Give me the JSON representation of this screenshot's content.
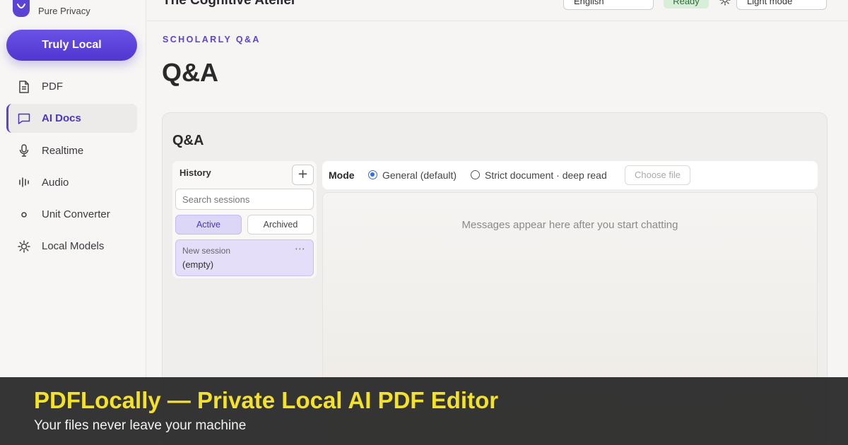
{
  "brand": {
    "subtitle": "Pure Privacy",
    "accent": "#5b43d6"
  },
  "sidebar": {
    "primary_button": "Truly Local",
    "items": [
      {
        "label": "PDF",
        "icon": "document-icon",
        "active": false
      },
      {
        "label": "AI Docs",
        "icon": "chat-bubble-icon",
        "active": true
      },
      {
        "label": "Realtime",
        "icon": "microphone-icon",
        "active": false
      },
      {
        "label": "Audio",
        "icon": "audio-waveform-icon",
        "active": false
      },
      {
        "label": "Unit Converter",
        "icon": "dot-icon",
        "active": false
      },
      {
        "label": "Local Models",
        "icon": "sun-gear-icon",
        "active": false
      }
    ]
  },
  "topbar": {
    "title": "The Cognitive Atelier",
    "language": "English",
    "status": "Ready",
    "status_color": "#d7efd9",
    "theme": "Light mode"
  },
  "page": {
    "eyebrow": "SCHOLARLY Q&A",
    "title": "Q&A"
  },
  "card": {
    "title": "Q&A",
    "history": {
      "title": "History",
      "add_label": "+",
      "search_placeholder": "Search sessions",
      "tabs": {
        "active": "Active",
        "archived": "Archived"
      },
      "sessions": [
        {
          "name": "New session",
          "preview": "(empty)",
          "more": "⋯"
        }
      ]
    },
    "mode": {
      "label": "Mode",
      "options": [
        {
          "label": "General (default)",
          "selected": true
        },
        {
          "label": "Strict document · deep read",
          "selected": false
        }
      ],
      "file_button": "Choose file"
    },
    "messages": {
      "empty_text": "Messages appear here after you start chatting"
    }
  },
  "banner": {
    "title": "PDFLocally — Private Local AI PDF Editor",
    "subtitle": "Your files never leave your machine",
    "title_color": "#f4e12a"
  }
}
